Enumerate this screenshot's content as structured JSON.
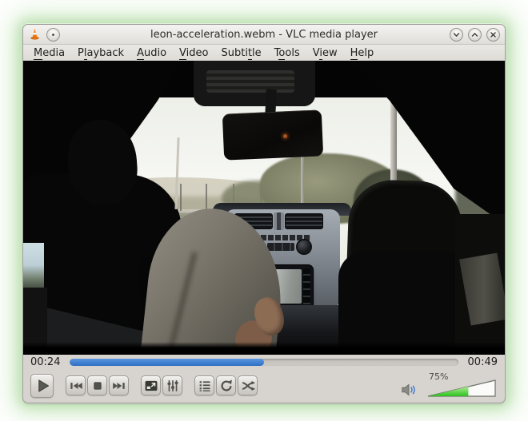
{
  "titlebar": {
    "title": "leon-acceleration.webm - VLC media player",
    "left_icons": [
      "vlc-cone-icon",
      "pin-icon"
    ],
    "window_buttons": [
      {
        "name": "minimize",
        "icon": "chevron-down-icon"
      },
      {
        "name": "maximize",
        "icon": "chevron-up-icon"
      },
      {
        "name": "close",
        "icon": "close-icon"
      }
    ]
  },
  "menubar": {
    "items": [
      {
        "label": "Media",
        "mnemonic": 0
      },
      {
        "label": "Playback",
        "mnemonic": 1
      },
      {
        "label": "Audio",
        "mnemonic": 0
      },
      {
        "label": "Video",
        "mnemonic": 0
      },
      {
        "label": "Subtitle",
        "mnemonic": 5
      },
      {
        "label": "Tools",
        "mnemonic": 1
      },
      {
        "label": "View",
        "mnemonic": 1
      },
      {
        "label": "Help",
        "mnemonic": 0
      }
    ]
  },
  "video": {
    "scene": "Rear-seat view inside a car: driver silhouette at left, rear-view mirror top centre, glowing sat-nav screen on the centre console, overexposed sky, trees and roadside poles through the windscreen, dark seats framing the view"
  },
  "seekbar": {
    "elapsed": "00:24",
    "duration": "00:49",
    "progress_percent": 50
  },
  "controls": {
    "buttons": [
      {
        "name": "play",
        "icon": "play-icon",
        "size": "large",
        "gap_before": false
      },
      {
        "name": "previous",
        "icon": "skip-back-icon",
        "gap_before": true
      },
      {
        "name": "stop",
        "icon": "stop-icon",
        "gap_before": false
      },
      {
        "name": "next",
        "icon": "skip-forward-icon",
        "gap_before": false
      },
      {
        "name": "fullscreen",
        "icon": "fullscreen-icon",
        "gap_before": true
      },
      {
        "name": "extended-settings",
        "icon": "equalizer-icon",
        "gap_before": false
      },
      {
        "name": "playlist",
        "icon": "playlist-icon",
        "gap_before": true
      },
      {
        "name": "loop",
        "icon": "loop-icon",
        "gap_before": false
      },
      {
        "name": "shuffle",
        "icon": "shuffle-icon",
        "gap_before": false
      }
    ]
  },
  "volume": {
    "label": "75%",
    "percent": 75,
    "fill_percent": 60,
    "speaker_icon": "speaker-icon"
  },
  "colors": {
    "seek_fill": "#3b82d4",
    "volume_fill": "#3ecb2e",
    "glow": "#8ecb7e",
    "titlebar_bg": "#e8e6e2",
    "controls_bg": "#d7d3cf"
  }
}
